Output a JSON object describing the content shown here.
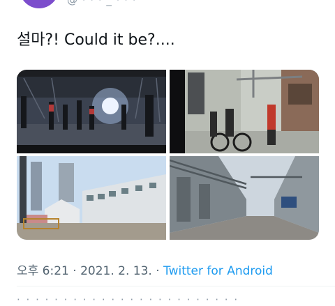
{
  "author": {
    "handle_fragment": "@ · · · _ · · · "
  },
  "tweet": {
    "text": "설마?! Could it be?....",
    "media": [
      {
        "alt": "dark warehouse dance scene with spotlight"
      },
      {
        "alt": "people with bicycle in alley beside industrial building"
      },
      {
        "alt": "empty lot with brick building and high-rise towers"
      },
      {
        "alt": "industrial alley with pipes and warehouses"
      }
    ]
  },
  "meta": {
    "time": "오후 6:21",
    "sep1": " · ",
    "date": "2021. 2. 13.",
    "sep2": " · ",
    "source": "Twitter for Android"
  },
  "colors": {
    "meta_gray": "#536471",
    "link_blue": "#1d9bf0",
    "avatar_purple": "#7c4dcc",
    "avatar_yellow": "#f1c232"
  }
}
